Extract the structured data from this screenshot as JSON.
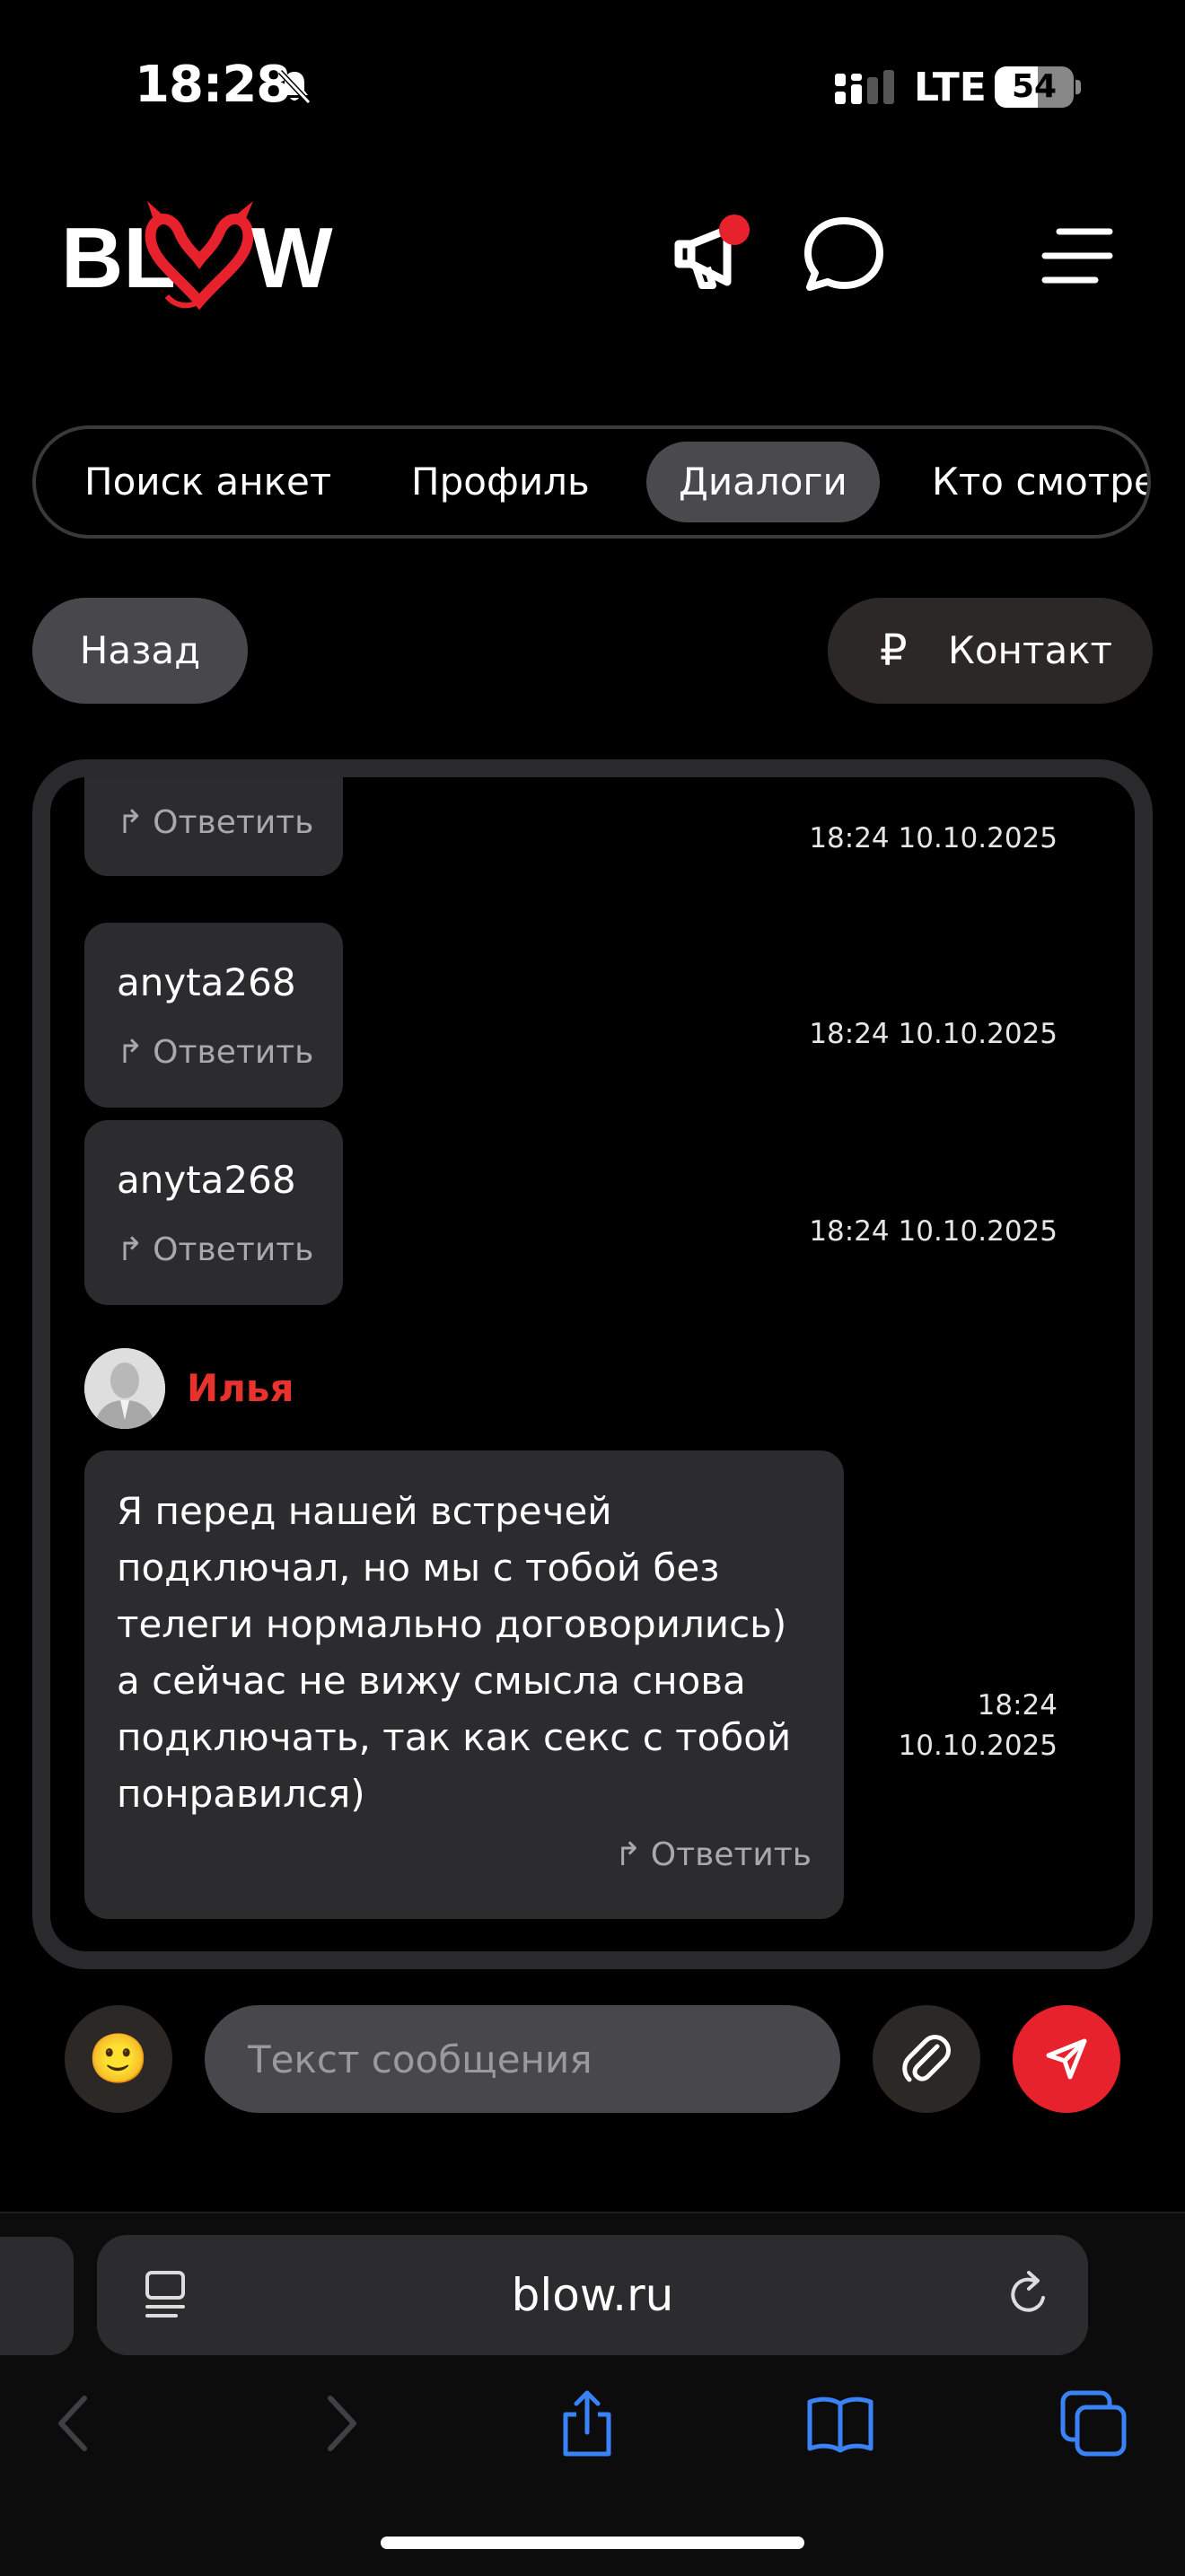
{
  "status_bar": {
    "time": "18:28",
    "network": "LTE",
    "battery": "54",
    "battery_level": 0.54
  },
  "header": {
    "logo_text": "BLOW",
    "notification_dot_color": "#e8222c"
  },
  "tabs": [
    {
      "label": "Поиск анкет"
    },
    {
      "label": "Профиль"
    },
    {
      "label": "Диалоги"
    },
    {
      "label": "Кто смотре"
    }
  ],
  "active_tab": "Диалоги",
  "buttons": {
    "back": "Назад",
    "contact": "Контакт",
    "currency_symbol": "₽"
  },
  "messages": [
    {
      "name": "",
      "reply": "Ответить",
      "time": "18:24 10.10.2025"
    },
    {
      "name": "anyta268",
      "reply": "Ответить",
      "time": "18:24 10.10.2025"
    },
    {
      "name": "anyta268",
      "reply": "Ответить",
      "time": "18:24 10.10.2025"
    }
  ],
  "incoming": {
    "author": "Илья",
    "text": "Я перед нашей встречей подключал, но мы с тобой без телеги нормально договорились) а сейчас не вижу смысла снова подключать, так как секс с тобой понравился)",
    "reply": "Ответить",
    "time_line1": "18:24",
    "time_line2": "10.10.2025"
  },
  "composer": {
    "placeholder": "Текст сообщения",
    "emoji": "🙂"
  },
  "browser": {
    "url": "blow.ru"
  },
  "colors": {
    "accent": "#e8222c",
    "author": "#e8322e",
    "ios_blue": "#3a82f7"
  }
}
